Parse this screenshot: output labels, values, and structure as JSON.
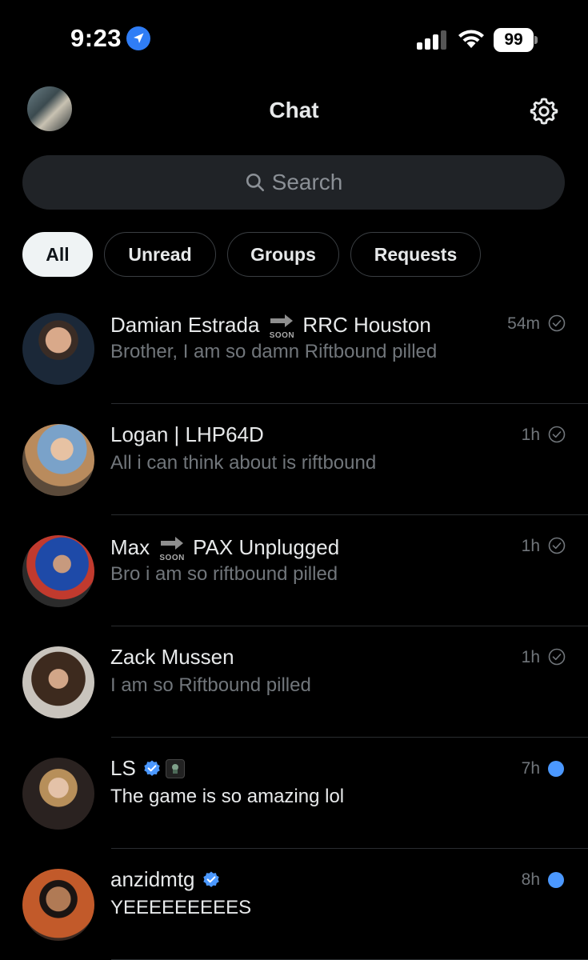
{
  "status_bar": {
    "time": "9:23",
    "battery": "99"
  },
  "header": {
    "title": "Chat"
  },
  "search": {
    "placeholder": "Search"
  },
  "filters": [
    {
      "label": "All",
      "active": true
    },
    {
      "label": "Unread",
      "active": false
    },
    {
      "label": "Groups",
      "active": false
    },
    {
      "label": "Requests",
      "active": false
    }
  ],
  "conversations": [
    {
      "name_before": "Damian Estrada",
      "soon": true,
      "name_after": "RRC Houston",
      "preview": "Brother, I am so damn Riftbound pilled",
      "time": "54m",
      "status": "read",
      "verified": false
    },
    {
      "name_before": "Logan | LHP64D",
      "soon": false,
      "name_after": "",
      "preview": "All i can think about is riftbound",
      "time": "1h",
      "status": "read",
      "verified": false
    },
    {
      "name_before": "Max",
      "soon": true,
      "name_after": "PAX Unplugged",
      "preview": "Bro i am so riftbound pilled",
      "time": "1h",
      "status": "read",
      "verified": false
    },
    {
      "name_before": "Zack Mussen",
      "soon": false,
      "name_after": "",
      "preview": "I am so Riftbound pilled",
      "time": "1h",
      "status": "read",
      "verified": false
    },
    {
      "name_before": "LS",
      "soon": false,
      "name_after": "",
      "preview": "The game is so amazing lol",
      "time": "7h",
      "status": "unread",
      "verified": true,
      "badge": true
    },
    {
      "name_before": "anzidmtg",
      "soon": false,
      "name_after": "",
      "preview": "YEEEEEEEEES",
      "time": "8h",
      "status": "unread",
      "verified": true
    }
  ],
  "soon_label": "SOON",
  "colors": {
    "background": "#000000",
    "accent_blue": "#4b98ff",
    "muted_text": "#71767b"
  }
}
